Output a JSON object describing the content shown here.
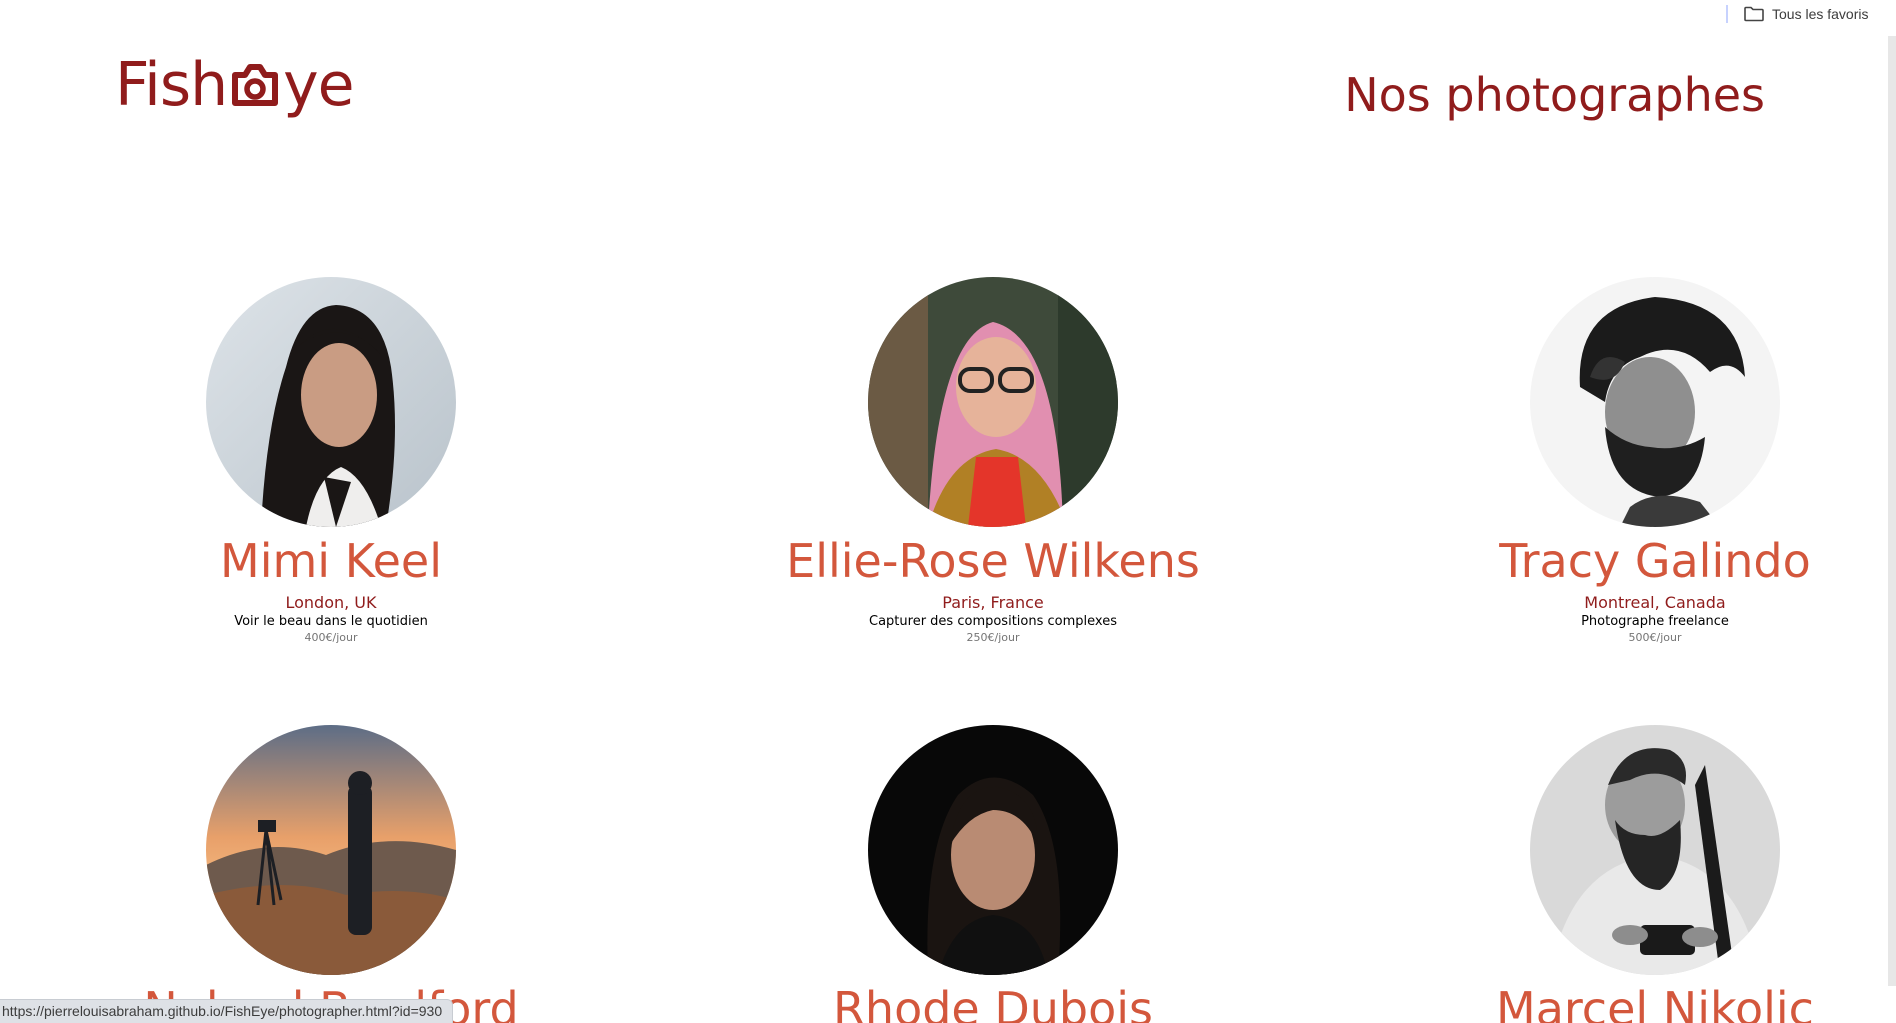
{
  "browser": {
    "bookmarks_folder_label": "Tous les favoris",
    "status_url": "https://pierrelouisabraham.github.io/FishEye/photographer.html?id=930"
  },
  "header": {
    "logo_text_left": "Fish",
    "logo_text_right": "ye",
    "logo_icon": "camera-icon",
    "title": "Nos photographes"
  },
  "colors": {
    "brand_dark": "#901c1c",
    "brand_accent": "#d3573c",
    "tagline": "#000000",
    "price": "#757575"
  },
  "photographers": [
    {
      "name": "Mimi Keel",
      "location": "London, UK",
      "tagline": "Voir le beau dans le quotidien",
      "price": "400€/jour"
    },
    {
      "name": "Ellie-Rose Wilkens",
      "location": "Paris, France",
      "tagline": "Capturer des compositions complexes",
      "price": "250€/jour"
    },
    {
      "name": "Tracy Galindo",
      "location": "Montreal, Canada",
      "tagline": "Photographe freelance",
      "price": "500€/jour"
    },
    {
      "name": "Nabeel Bradford",
      "location": "",
      "tagline": "",
      "price": ""
    },
    {
      "name": "Rhode Dubois",
      "location": "",
      "tagline": "",
      "price": ""
    },
    {
      "name": "Marcel Nikolic",
      "location": "",
      "tagline": "",
      "price": ""
    }
  ]
}
